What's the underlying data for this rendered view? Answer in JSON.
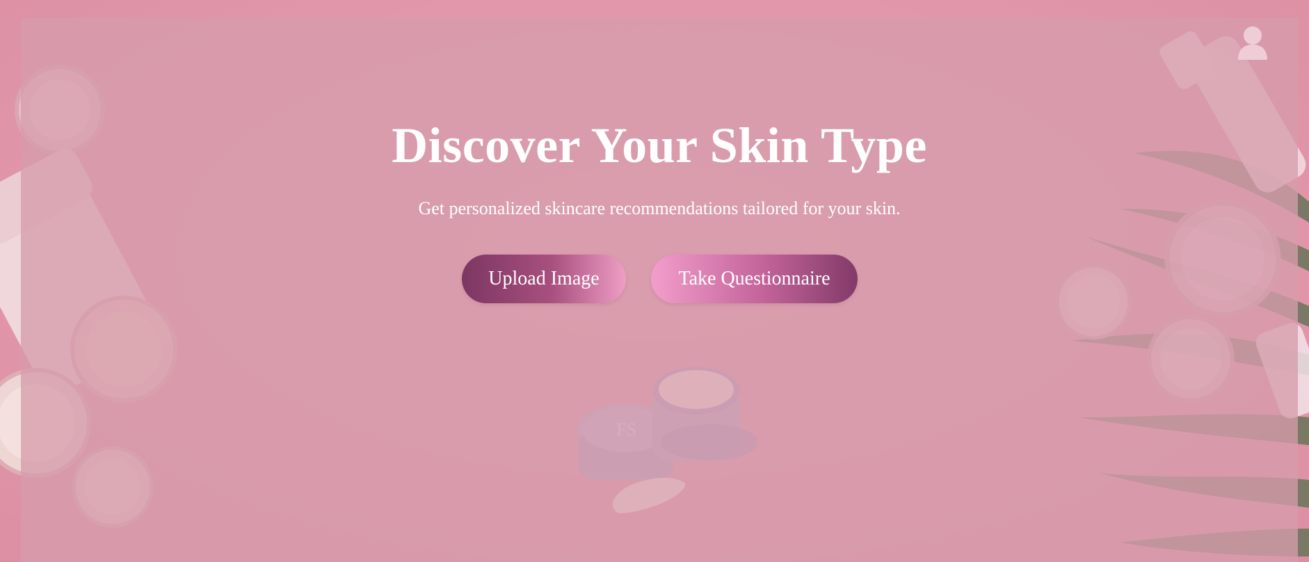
{
  "hero": {
    "title": "Discover Your Skin Type",
    "subtitle": "Get personalized skincare recommendations tailored for your skin."
  },
  "actions": {
    "upload_label": "Upload Image",
    "questionnaire_label": "Take Questionnaire"
  },
  "header": {
    "profile_icon": "user-icon"
  },
  "colors": {
    "page_background": "#f3b5bd",
    "overlay": "#d69cac",
    "text": "#ffffff",
    "button_dark": "#7c3662",
    "button_light": "#ef9ec5"
  }
}
